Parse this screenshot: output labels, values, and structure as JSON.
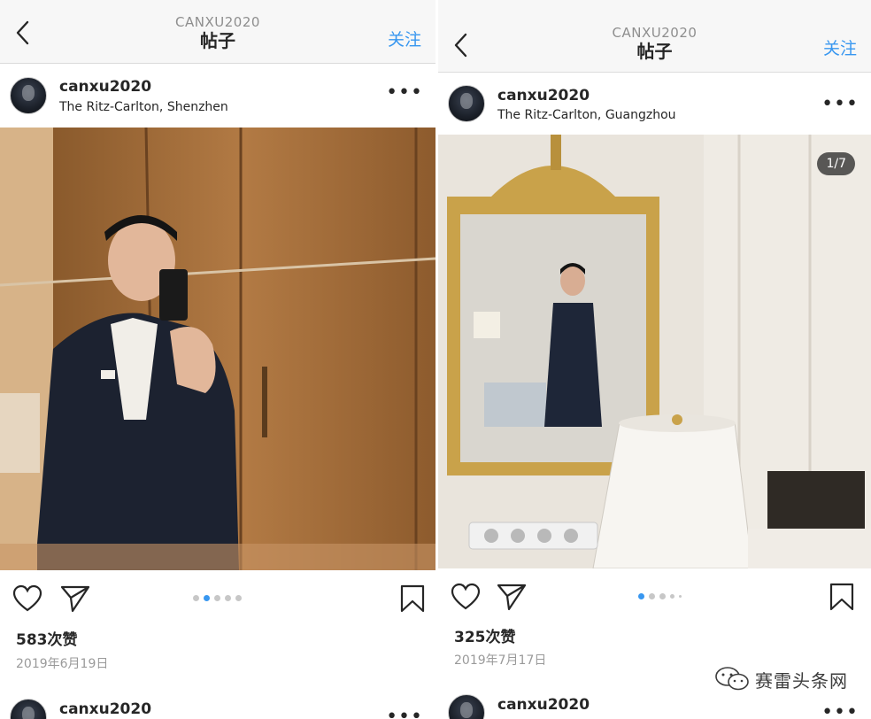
{
  "panels": [
    {
      "nav": {
        "username": "CANXU2020",
        "title": "帖子",
        "follow": "关注"
      },
      "post": {
        "user": "canxu2020",
        "location": "The Ritz-Carlton, Shenzhen",
        "photo_icon": "mirror-selfie-photo",
        "carousel": {
          "count": 5,
          "active_index": 1
        },
        "likes": "583次赞",
        "date": "2019年6月19日"
      },
      "next_post": {
        "user": "canxu2020"
      }
    },
    {
      "nav": {
        "username": "CANXU2020",
        "title": "帖子",
        "follow": "关注"
      },
      "post": {
        "user": "canxu2020",
        "location": "The Ritz-Carlton, Guangzhou",
        "photo_icon": "mirror-selfie-photo",
        "image_counter": "1/7",
        "carousel": {
          "count": 5,
          "active_index": 0
        },
        "likes": "325次赞",
        "date": "2019年7月17日"
      },
      "next_post": {
        "user": "canxu2020"
      }
    }
  ],
  "watermark": {
    "text": "赛雷头条网",
    "icon": "wechat-icon"
  },
  "colors": {
    "accent": "#3897f0",
    "text": "#262626",
    "muted": "#8e8e8e",
    "nav_bg": "#f7f7f7"
  }
}
